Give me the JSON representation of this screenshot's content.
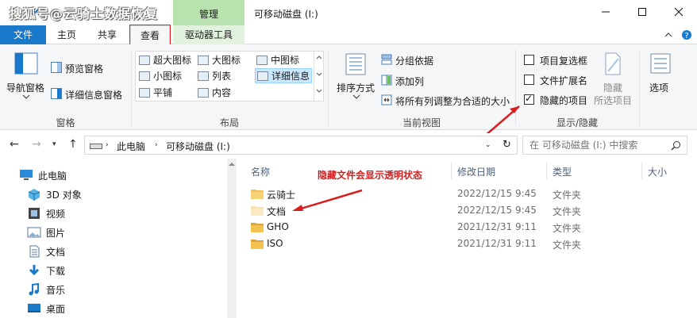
{
  "watermark": "搜狐号@云骑士数据恢复",
  "window": {
    "title": "可移动磁盘 (I:)",
    "context_tab_group": "管理",
    "minimize_icon": "minimize-icon",
    "maximize_icon": "maximize-icon",
    "close_icon": "close-icon"
  },
  "tabs": [
    {
      "label": "文件"
    },
    {
      "label": "主页"
    },
    {
      "label": "共享"
    },
    {
      "label": "查看"
    },
    {
      "label": "驱动器工具"
    }
  ],
  "ribbon": {
    "panes": {
      "nav_pane": "导航窗格",
      "preview_pane": "预览窗格",
      "details_pane": "详细信息窗格",
      "group_label": "窗格"
    },
    "layout": {
      "items": [
        "超大图标",
        "大图标",
        "中图标",
        "小图标",
        "列表",
        "详细信息",
        "平铺",
        "内容"
      ],
      "selected": "详细信息",
      "group_label": "布局"
    },
    "current_view": {
      "sort_by": "排序方式",
      "group_by": "分组依据",
      "add_column": "添加列",
      "fit_columns": "将所有列调整为合适的大小",
      "group_label": "当前视图"
    },
    "show_hide": {
      "item_checkboxes": {
        "label": "项目复选框",
        "checked": false
      },
      "file_extensions": {
        "label": "文件扩展名",
        "checked": false
      },
      "hidden_items": {
        "label": "隐藏的项目",
        "checked": true
      },
      "hide_selected": "隐藏",
      "hide_selected_sub": "所选项目",
      "group_label": "显示/隐藏"
    },
    "options": "选项"
  },
  "address": {
    "segments": [
      "此电脑",
      "可移动磁盘 (I:)"
    ],
    "search_placeholder": "在 可移动磁盘 (I:) 中搜索"
  },
  "nav_pane": {
    "items": [
      {
        "label": "此电脑",
        "icon": "computer-icon"
      },
      {
        "label": "3D 对象",
        "icon": "cube-icon"
      },
      {
        "label": "视频",
        "icon": "video-icon"
      },
      {
        "label": "图片",
        "icon": "picture-icon"
      },
      {
        "label": "文档",
        "icon": "document-icon"
      },
      {
        "label": "下载",
        "icon": "download-icon"
      },
      {
        "label": "音乐",
        "icon": "music-icon"
      },
      {
        "label": "桌面",
        "icon": "desktop-icon"
      }
    ]
  },
  "file_list": {
    "columns": [
      "名称",
      "修改日期",
      "类型",
      "大小"
    ],
    "rows": [
      {
        "name": "云骑士",
        "date": "2022/12/15 9:45",
        "type": "文件夹",
        "hidden": false
      },
      {
        "name": "文档",
        "date": "2022/12/15 9:45",
        "type": "文件夹",
        "hidden": true
      },
      {
        "name": "GHO",
        "date": "2021/12/31 9:11",
        "type": "文件夹",
        "hidden": false
      },
      {
        "name": "ISO",
        "date": "2021/12/31 9:11",
        "type": "文件夹",
        "hidden": false
      }
    ]
  },
  "annotation": "隐藏文件会显示透明状态",
  "colors": {
    "file_tab": "#1979ca",
    "context_tab": "#b9e3ae",
    "annotation": "#d81e1e",
    "folder": "#f2c14e"
  }
}
